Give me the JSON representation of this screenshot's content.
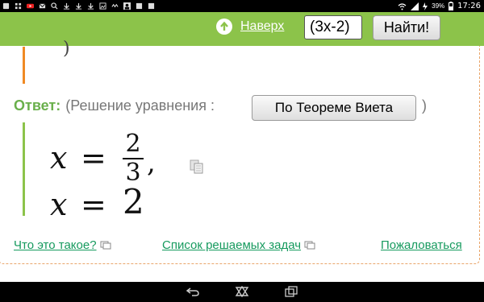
{
  "status_bar": {
    "time": "17:26",
    "battery": "39%",
    "icons": [
      "app-icon",
      "grid-icon",
      "youtube-icon",
      "messages-icon",
      "search-icon",
      "download-icon",
      "download-icon",
      "download-icon",
      "image-icon",
      "sync-icon",
      "person-icon",
      "image-icon",
      "image-icon",
      "wifi-icon",
      "signal-icon",
      "charging-icon",
      "battery-icon"
    ]
  },
  "header": {
    "up_link": "Наверх",
    "search_value": "(3x-2)",
    "search_button": "Найти!"
  },
  "answer": {
    "label": "Ответ:",
    "prefix": "(Решение уравнения :",
    "method_button": "По Теореме Виета",
    "suffix": ")",
    "solution1_var": "x",
    "solution1_eq": "=",
    "solution1_num": "2",
    "solution1_den": "3",
    "solution1_comma": ",",
    "solution2_var": "x",
    "solution2_eq": "=",
    "solution2_val": "2",
    "paren_tail": ")"
  },
  "footer_links": {
    "what_is_this": "Что это такое?",
    "task_list": "Список решаемых задач",
    "complain": "Пожаловаться"
  },
  "colors": {
    "accent_green": "#8cc34a",
    "answer_green": "#6ab04c",
    "link_green": "#169a5e",
    "orange": "#f08a24"
  }
}
